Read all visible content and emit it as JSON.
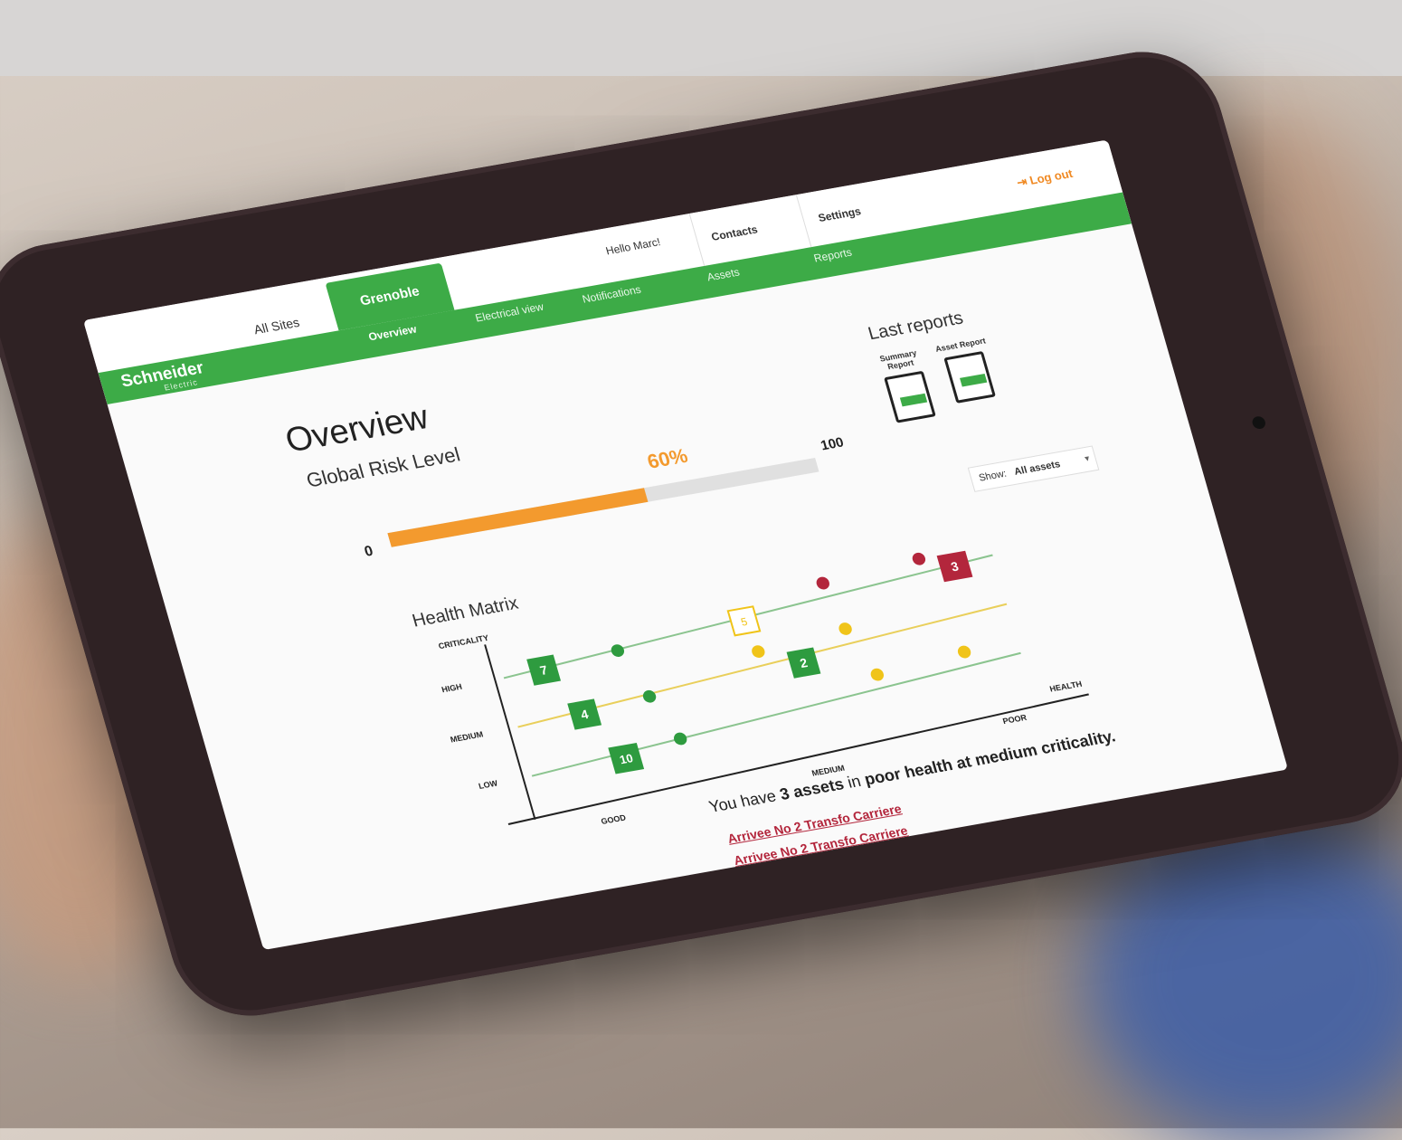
{
  "brand": {
    "name": "Schneider",
    "sub": "Electric"
  },
  "nav": {
    "tabs": [
      {
        "label": "All Sites"
      },
      {
        "label": "Grenoble"
      }
    ],
    "subnav": [
      "Overview",
      "Electrical view",
      "Notifications",
      "Assets",
      "Reports"
    ],
    "greeting": "Hello Marc!",
    "top": [
      "Contacts",
      "Settings"
    ],
    "logout": "Log out"
  },
  "overview": {
    "title": "Overview",
    "risk_title": "Global Risk Level",
    "risk_min": "0",
    "risk_max": "100",
    "risk_value_label": "60%",
    "risk_value": 0.6
  },
  "reports": {
    "title": "Last reports",
    "items": [
      {
        "label": "Summary Report"
      },
      {
        "label": "Asset Report"
      }
    ]
  },
  "filter": {
    "label": "Show:",
    "value": "All assets"
  },
  "matrix": {
    "title": "Health Matrix",
    "y_axis": "CRITICALITY",
    "x_axis": "HEALTH",
    "y_levels": [
      "HIGH",
      "MEDIUM",
      "LOW"
    ],
    "x_levels": [
      "GOOD",
      "MEDIUM",
      "POOR"
    ],
    "cells": [
      {
        "value": "7",
        "status": "good"
      },
      {
        "value": "4",
        "status": "good"
      },
      {
        "value": "10",
        "status": "good"
      },
      {
        "value": "2",
        "status": "good"
      },
      {
        "value": "5",
        "status": "selected"
      },
      {
        "value": "3",
        "status": "poor"
      }
    ],
    "colors": {
      "good": "#2e9b3f",
      "medium": "#f0c419",
      "poor": "#b3263c",
      "axis": "#222222"
    }
  },
  "summary": {
    "prefix": "You have",
    "count": "3 assets",
    "mid": "in",
    "health": "poor health",
    "suffix": "at medium criticality."
  },
  "assets": [
    {
      "label": "Arrivee No 2 Transfo Carriere"
    },
    {
      "label": "Arrivee No 2 Transfo Carriere"
    }
  ]
}
